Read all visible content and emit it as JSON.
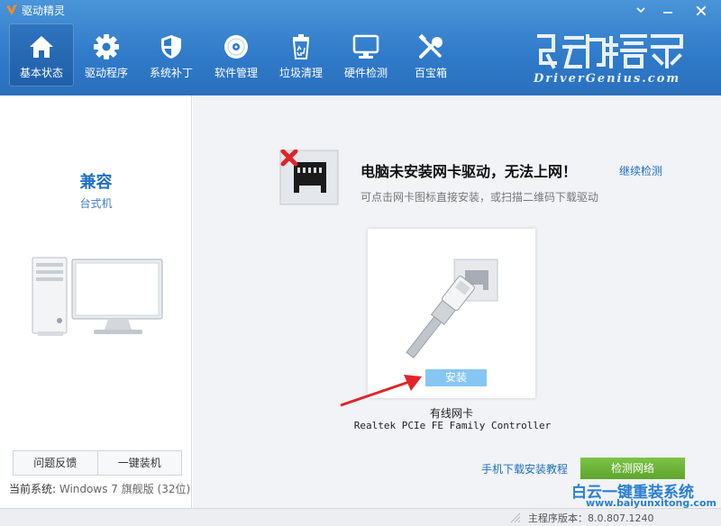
{
  "window": {
    "title": "驱动精灵"
  },
  "nav": [
    {
      "label": "基本状态",
      "icon": "home-icon"
    },
    {
      "label": "驱动程序",
      "icon": "gear-icon"
    },
    {
      "label": "系统补丁",
      "icon": "shield-icon"
    },
    {
      "label": "软件管理",
      "icon": "disc-icon"
    },
    {
      "label": "垃圾清理",
      "icon": "recycle-bin-icon"
    },
    {
      "label": "硬件检测",
      "icon": "monitor-icon"
    },
    {
      "label": "百宝箱",
      "icon": "tools-icon"
    }
  ],
  "brand": {
    "cn": "驱动精灵",
    "en": "DriverGenius.com"
  },
  "left": {
    "pc_name": "兼容",
    "pc_type": "台式机",
    "feedback": "问题反馈",
    "one_click": "一键装机",
    "system_label": "当前系统:",
    "system_value": "Windows 7 旗舰版 (32位)"
  },
  "main": {
    "alert_title": "电脑未安装网卡驱动，无法上网！",
    "recheck": "继续检测",
    "alert_sub": "可点击网卡图标直接安装，或扫描二维码下载驱动",
    "install": "安装",
    "nic_name": "有线网卡",
    "nic_model": "Realtek PCIe FE Family Controller",
    "tutorial": "手机下载安装教程",
    "detect": "检测网络"
  },
  "watermark": {
    "text": "白云一键重装系统",
    "url": "www.baiyunxitong.com"
  },
  "status": {
    "version_label": "主程序版本：",
    "version": "8.0.807.1240"
  },
  "colors": {
    "header": "#2f7ac9",
    "accent": "#1e6fbd",
    "detect": "#6fb83a",
    "install": "#86c6f2",
    "alert_x": "#e0242a"
  }
}
